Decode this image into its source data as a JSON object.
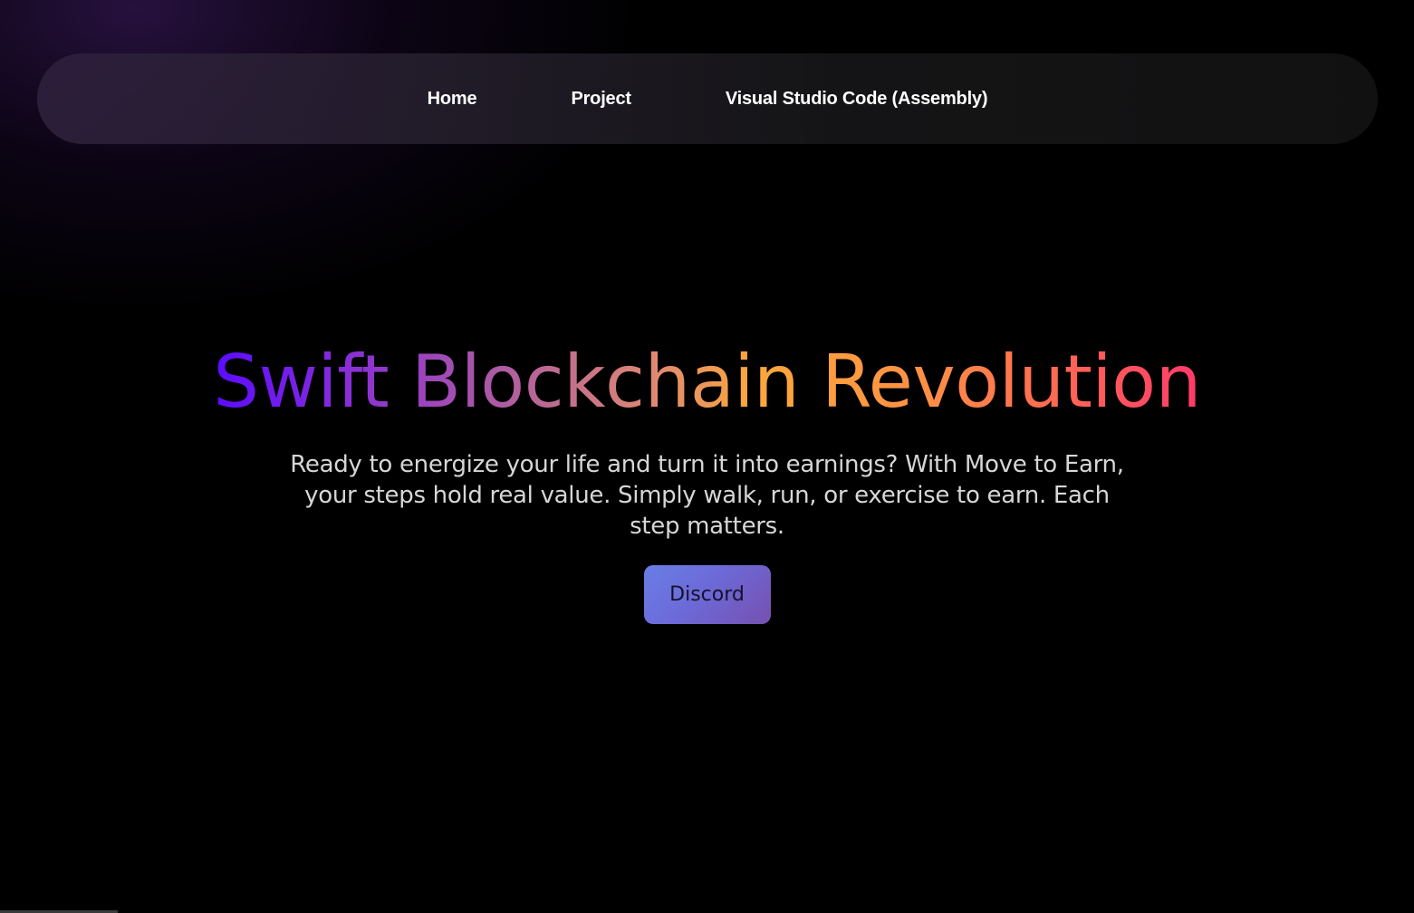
{
  "nav": {
    "items": [
      {
        "label": "Home"
      },
      {
        "label": "Project"
      },
      {
        "label": "Visual Studio Code (Assembly)"
      }
    ]
  },
  "hero": {
    "title": "Swift Blockchain Revolution",
    "description": "Ready to energize your life and turn it into earnings? With Move to Earn, your steps hold real value. Simply walk, run, or exercise to earn. Each step matters.",
    "cta_label": "Discord"
  },
  "colors": {
    "background": "#000000",
    "title_gradient": [
      "#5b0bff",
      "#b05ea0",
      "#fba83a",
      "#ff3a6a"
    ],
    "button_gradient": [
      "#6a7ee6",
      "#7650b0"
    ],
    "nav_text": "#ffffff",
    "body_text": "#d6d6d6"
  }
}
